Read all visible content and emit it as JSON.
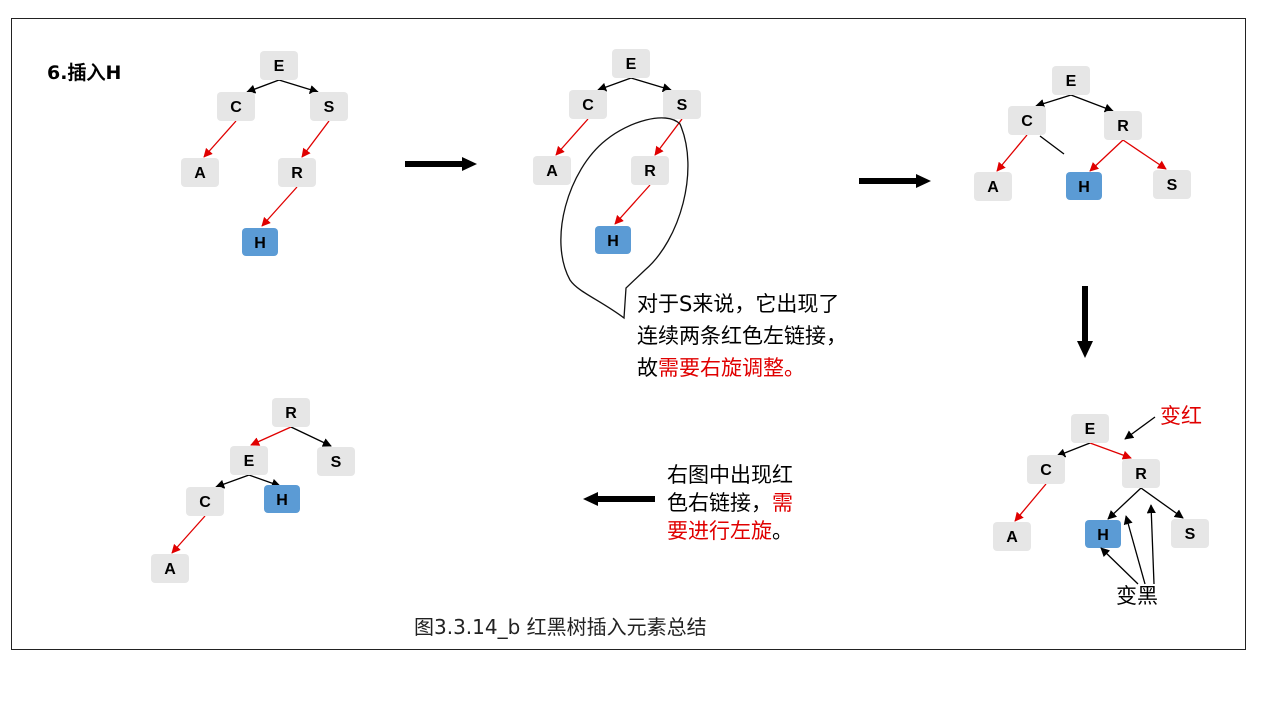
{
  "title": "6.插入H",
  "caption": "图3.3.14_b 红黑树插入元素总结",
  "colors": {
    "node_fill": "#e6e6e6",
    "highlight_fill": "#5b9bd5",
    "red_link": "#e00000",
    "black_link": "#000000",
    "arrow": "#000000"
  },
  "nodes": {
    "t1_E": "E",
    "t1_C": "C",
    "t1_S": "S",
    "t1_A": "A",
    "t1_R": "R",
    "t1_H": "H",
    "t2_E": "E",
    "t2_C": "C",
    "t2_S": "S",
    "t2_A": "A",
    "t2_R": "R",
    "t2_H": "H",
    "t3_E": "E",
    "t3_C": "C",
    "t3_R": "R",
    "t3_A": "A",
    "t3_H": "H",
    "t3_S": "S",
    "t4_E": "E",
    "t4_C": "C",
    "t4_R": "R",
    "t4_A": "A",
    "t4_H": "H",
    "t4_S": "S",
    "t5_R": "R",
    "t5_E": "E",
    "t5_S": "S",
    "t5_C": "C",
    "t5_H": "H",
    "t5_A": "A"
  },
  "note1": {
    "line1": "对于S来说，它出现了",
    "line2": "连续两条红色左链接，",
    "line3_black": "故",
    "line3_red": "需要右旋调整。"
  },
  "note2": {
    "line1": "右图中出现红",
    "line2_black": "色右链接，",
    "line2_red": "需",
    "line3_red": "要进行左旋",
    "line3_black": "。"
  },
  "label_to_red": "变红",
  "label_to_black": "变黑"
}
